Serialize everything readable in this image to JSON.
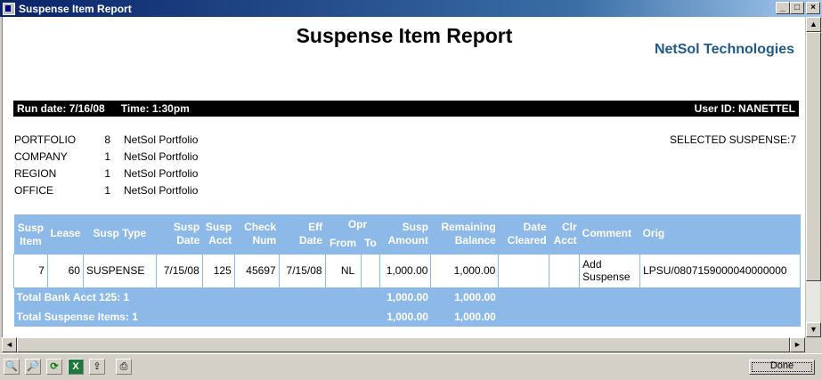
{
  "window": {
    "title": "Suspense Item Report",
    "buttons": {
      "minimize": "_",
      "maximize": "□",
      "close": "×"
    }
  },
  "report": {
    "title": "Suspense Item Report",
    "company": "NetSol Technologies",
    "run_date": "Run date: 7/16/08",
    "time": "Time: 1:30pm",
    "user_id": "User ID: NANETTEL",
    "selected_suspense": "SELECTED SUSPENSE:7",
    "org": [
      {
        "label": "PORTFOLIO",
        "num": "8",
        "name": "NetSol Portfolio"
      },
      {
        "label": "COMPANY",
        "num": "1",
        "name": "NetSol Portfolio"
      },
      {
        "label": "REGION",
        "num": "1",
        "name": "NetSol Portfolio"
      },
      {
        "label": "OFFICE",
        "num": "1",
        "name": "NetSol Portfolio"
      }
    ]
  },
  "table": {
    "headers": {
      "susp_item": [
        "Susp",
        "Item"
      ],
      "lease": "Lease",
      "susp_type": "Susp Type",
      "susp_date": [
        "Susp",
        "Date"
      ],
      "susp_acct": [
        "Susp",
        "Acct"
      ],
      "check_num": [
        "Check",
        "Num"
      ],
      "eff_date": [
        "Eff",
        "Date"
      ],
      "opr": "Opr",
      "from": "From",
      "to": "To",
      "susp_amount": [
        "Susp",
        "Amount"
      ],
      "remaining_balance": [
        "Remaining",
        "Balance"
      ],
      "date_cleared": [
        "Date",
        "Cleared"
      ],
      "clr_acct": [
        "Clr",
        "Acct"
      ],
      "comment": "Comment",
      "orig": "Orig"
    },
    "rows": [
      {
        "susp_item": "7",
        "lease": "60",
        "susp_type": "SUSPENSE",
        "susp_date": "7/15/08",
        "susp_acct": "125",
        "check_num": "45697",
        "eff_date": "7/15/08",
        "from": "NL",
        "to": "",
        "susp_amount": "1,000.00",
        "remaining_balance": "1,000.00",
        "date_cleared": "",
        "clr_acct": "",
        "comment": [
          "Add",
          "Suspense"
        ],
        "orig": "LPSU/0807159000040000000"
      }
    ],
    "totals": [
      {
        "label": "Total Bank Acct 125: 1",
        "susp_amount": "1,000.00",
        "remaining_balance": "1,000.00"
      },
      {
        "label": "Total Suspense Items: 1",
        "susp_amount": "1,000.00",
        "remaining_balance": "1,000.00"
      }
    ]
  },
  "scroll": {
    "up": "▲",
    "down": "▼",
    "left": "◄",
    "right": "►"
  },
  "toolbar": {
    "icons": [
      {
        "name": "zoom-out-icon",
        "glyph": "🔍"
      },
      {
        "name": "zoom-in-icon",
        "glyph": "🔎"
      },
      {
        "name": "refresh-icon",
        "glyph": "⟳"
      },
      {
        "name": "excel-export-icon",
        "glyph": "X"
      },
      {
        "name": "export-icon",
        "glyph": "⇪"
      },
      {
        "name": "print-icon",
        "glyph": "⎙"
      }
    ],
    "done_label": "Done"
  }
}
